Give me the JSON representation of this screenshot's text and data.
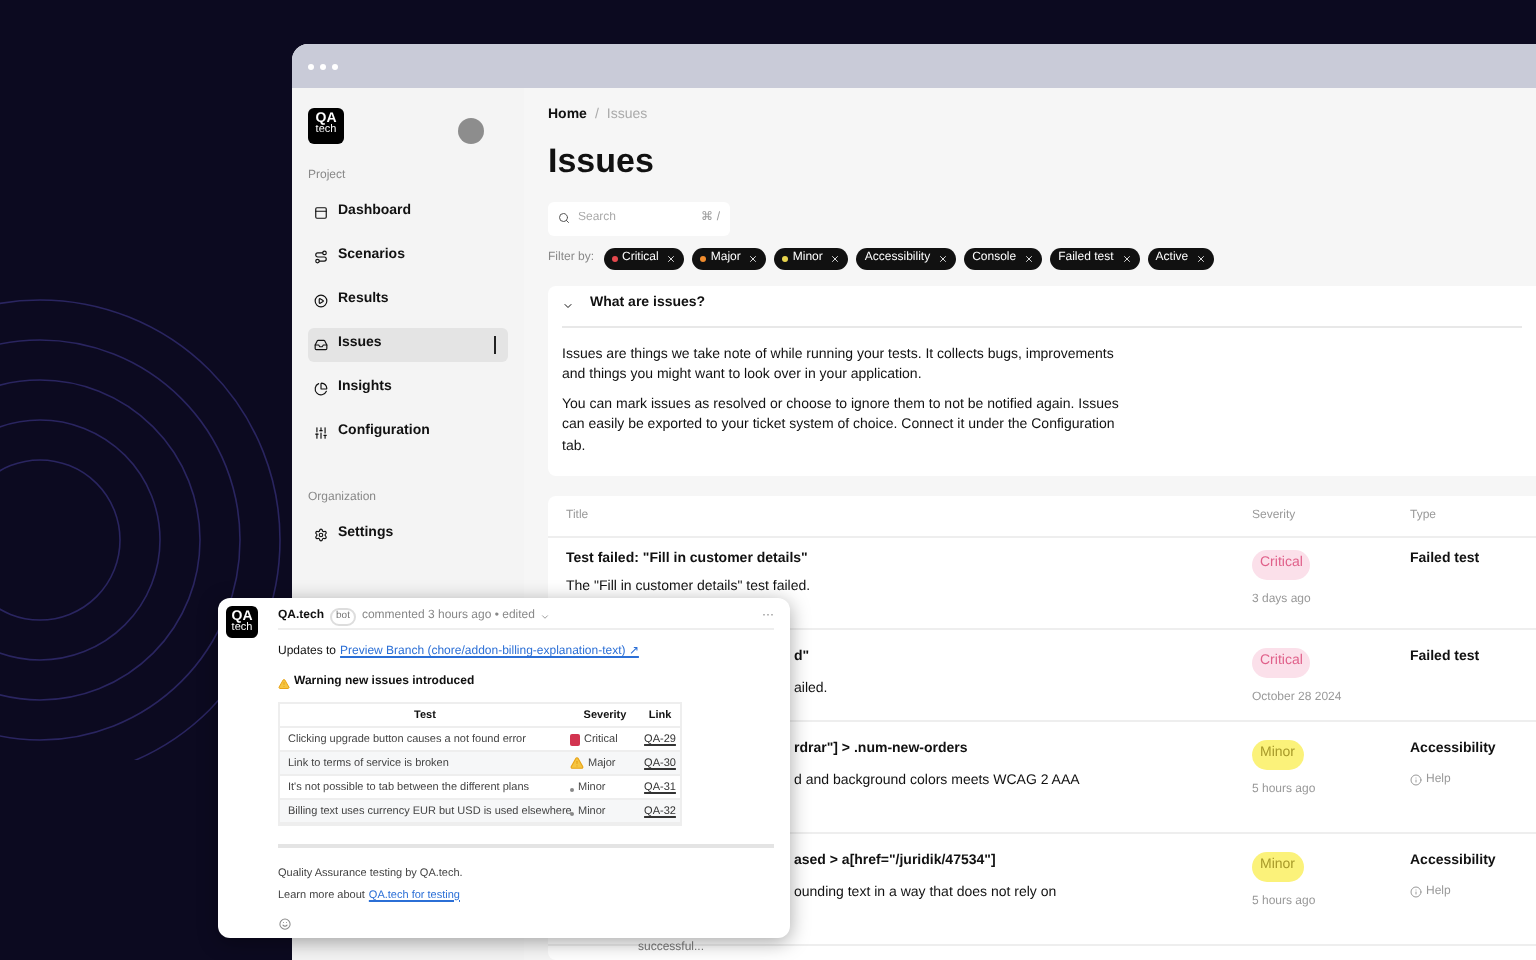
{
  "sidebar": {
    "logo": {
      "line1": "QA",
      "line2": "tech"
    },
    "sections": [
      {
        "heading": "Project",
        "items": [
          {
            "label": "Dashboard",
            "selected": false
          },
          {
            "label": "Scenarios",
            "selected": false
          },
          {
            "label": "Results",
            "selected": false
          },
          {
            "label": "Issues",
            "selected": true
          },
          {
            "label": "Insights",
            "selected": false
          },
          {
            "label": "Configuration",
            "selected": false
          }
        ]
      },
      {
        "heading": "Organization",
        "items": [
          {
            "label": "Settings",
            "selected": false
          }
        ]
      }
    ]
  },
  "breadcrumb": [
    "Home",
    "/",
    "Issues"
  ],
  "title": "Issues",
  "search": {
    "placeholder": "Search",
    "shortcut": "⌘ /"
  },
  "filter": {
    "label": "Filter by:",
    "chips": [
      {
        "label": "Critical",
        "color": "#e5484d"
      },
      {
        "label": "Major",
        "color": "#f08c2e"
      },
      {
        "label": "Minor",
        "color": "#e8d44d"
      },
      {
        "label": "Accessibility"
      },
      {
        "label": "Console"
      },
      {
        "label": "Failed test"
      },
      {
        "label": "Active"
      }
    ]
  },
  "info": {
    "heading": "What are issues?",
    "expanded": true,
    "paragraphs": [
      "Issues are things we take note of while running your tests. It collects bugs, improvements and things you might want to look over in your application.",
      "You can mark issues as resolved or choose to ignore them to not be notified again. Issues can easily be exported to your ticket system of choice. Connect it under the Configuration tab."
    ]
  },
  "table": {
    "columns": [
      "Title",
      "Severity",
      "Type"
    ],
    "rows": [
      {
        "title": "Test failed: \"Fill in customer details\"",
        "lines": [
          "The \"Fill in customer details\" test failed."
        ],
        "covered": false,
        "severity": {
          "label": "Critical",
          "kind": "critical"
        },
        "time": "3 days ago",
        "type": "Failed test"
      },
      {
        "title": "d\"",
        "lines": [
          "ailed."
        ],
        "covered": true,
        "severity": {
          "label": "Critical",
          "kind": "critical"
        },
        "time": "October 28 2024",
        "type": "Failed test"
      },
      {
        "title": "rdrar\"] > .num-new-orders",
        "lines": [
          "d and background colors meets WCAG 2 AAA"
        ],
        "covered": true,
        "severity": {
          "label": "Minor",
          "kind": "minor"
        },
        "time": "5 hours ago",
        "type": "Accessibility",
        "help": "Help"
      },
      {
        "title": "ased > a[href=\"/juridik/47534\"]",
        "lines": [
          "ounding text in a way that does not rely on"
        ],
        "covered": true,
        "extra": "successful...",
        "severity": {
          "label": "Minor",
          "kind": "minor"
        },
        "time": "5 hours ago",
        "type": "Accessibility",
        "help": "Help"
      }
    ]
  },
  "comment": {
    "logo": {
      "line1": "QA",
      "line2": "tech"
    },
    "author": "QA.tech",
    "badge": "bot",
    "meta": "commented 3 hours ago • edited",
    "menu": "···",
    "updates_prefix": "Updates to",
    "updates_link": "Preview Branch (chore/addon-billing-explanation-text) ↗",
    "warning": "Warning new issues introduced",
    "columns": [
      "Test",
      "Severity",
      "Link"
    ],
    "rows": [
      {
        "test": "Clicking upgrade button causes a not found error",
        "severity": "Critical",
        "kind": "critical",
        "link": "QA-29"
      },
      {
        "test": "Link to terms of service is broken",
        "severity": "Major",
        "kind": "major",
        "link": "QA-30"
      },
      {
        "test": "It's not possible to tab between the different plans",
        "severity": "Minor",
        "kind": "minor",
        "link": "QA-31"
      },
      {
        "test": "Billing text uses currency EUR but USD is used elsewhere",
        "severity": "Minor",
        "kind": "minor",
        "link": "QA-32"
      }
    ],
    "footer": "Quality Assurance testing by QA.tech.",
    "learn_prefix": "Learn more about",
    "learn_link": "QA.tech for testing"
  }
}
